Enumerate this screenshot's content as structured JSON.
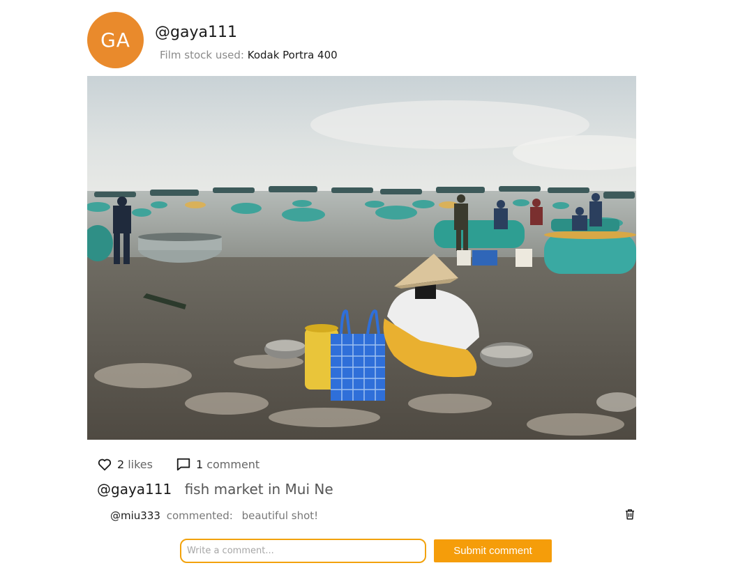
{
  "post": {
    "avatar_initials": "GA",
    "avatar_color": "#e98a2c",
    "username": "@gaya111",
    "film_label": "Film stock used:",
    "film_stock": "Kodak Portra 400",
    "photo": {
      "subject": "fish market on beach with basket boats",
      "alt_icon": "photo"
    },
    "likes": {
      "count": "2",
      "label": "likes",
      "icon": "heart-icon"
    },
    "comments_stat": {
      "count": "1",
      "label": "comment",
      "icon": "comment-icon"
    },
    "caption": {
      "user": "@gaya111",
      "text": "fish market in Mui Ne"
    },
    "comments": [
      {
        "user": "@miu333",
        "verb": "commented:",
        "text": "beautiful shot!",
        "delete_icon": "trash-icon"
      }
    ],
    "form": {
      "placeholder": "Write a comment...",
      "value": "",
      "submit_label": "Submit comment",
      "accent": "#f59d0a"
    }
  }
}
